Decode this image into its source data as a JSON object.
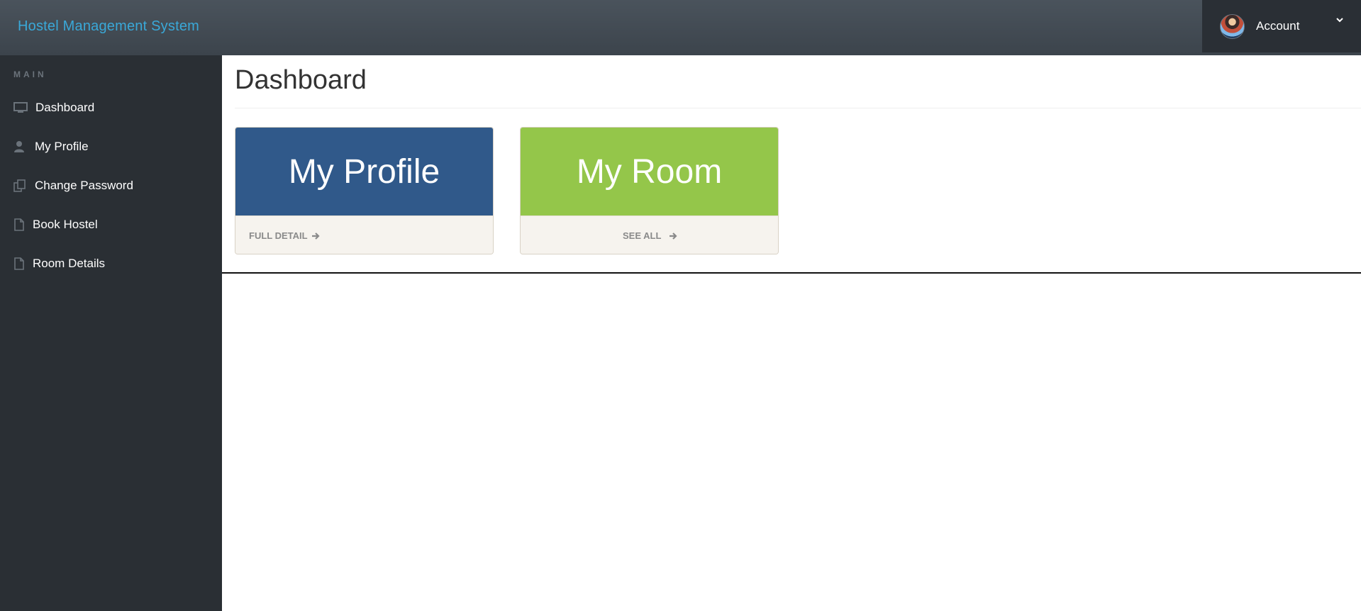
{
  "app": {
    "title": "Hostel Management System"
  },
  "account": {
    "label": "Account"
  },
  "sidebar": {
    "section_label": "MAIN",
    "items": [
      {
        "label": "Dashboard",
        "icon": "desktop-icon"
      },
      {
        "label": "My Profile",
        "icon": "user-icon"
      },
      {
        "label": "Change Password",
        "icon": "files-icon"
      },
      {
        "label": "Book Hostel",
        "icon": "file-icon"
      },
      {
        "label": "Room Details",
        "icon": "file-icon"
      }
    ]
  },
  "main": {
    "page_title": "Dashboard",
    "cards": [
      {
        "title": "My Profile",
        "link_label": "FULL DETAIL",
        "color": "#30598a"
      },
      {
        "title": "My Room",
        "link_label": "SEE ALL",
        "color": "#94c64a"
      }
    ]
  },
  "colors": {
    "brand": "#3aa8d8",
    "topbar": "#434b53",
    "sidebar": "#2a2f34",
    "profile_card": "#30598a",
    "room_card": "#94c64a"
  }
}
